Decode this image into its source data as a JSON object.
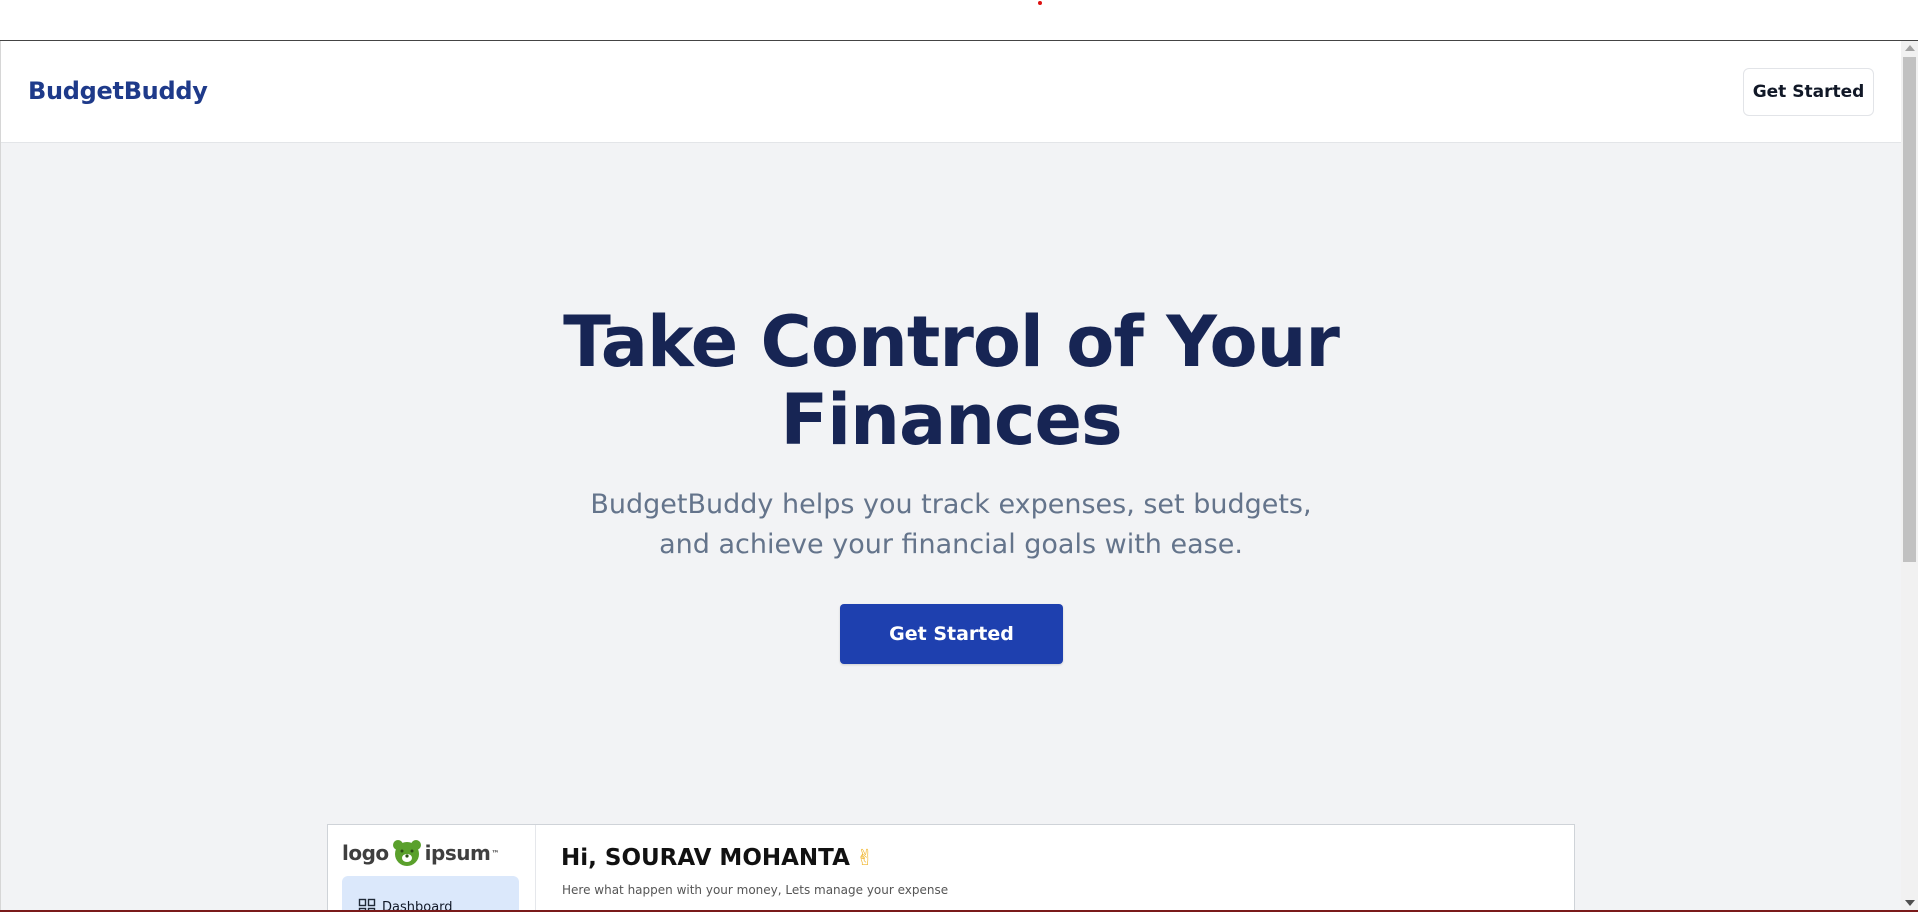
{
  "header": {
    "brand": "BudgetBuddy",
    "cta_label": "Get Started"
  },
  "hero": {
    "title_line1": "Take Control of Your",
    "title_line2": "Finances",
    "subtitle_line1": "BudgetBuddy helps you track expenses, set budgets,",
    "subtitle_line2": "and achieve your financial goals with ease.",
    "cta_label": "Get Started"
  },
  "preview": {
    "logo_left": "logo",
    "logo_right": "ipsum",
    "logo_tm": "™",
    "nav_dashboard": "Dashboard",
    "greeting": "Hi, SOURAV MOHANTA",
    "greeting_icon": "victory-hand-icon",
    "tagline": "Here what happen with your money, Lets manage your expense"
  },
  "colors": {
    "brand": "#1e3a8a",
    "hero_title": "#172554",
    "primary_button": "#1e40af",
    "page_background": "#f2f3f5",
    "subtitle": "#64748b",
    "logo_green": "#5aa02c"
  }
}
